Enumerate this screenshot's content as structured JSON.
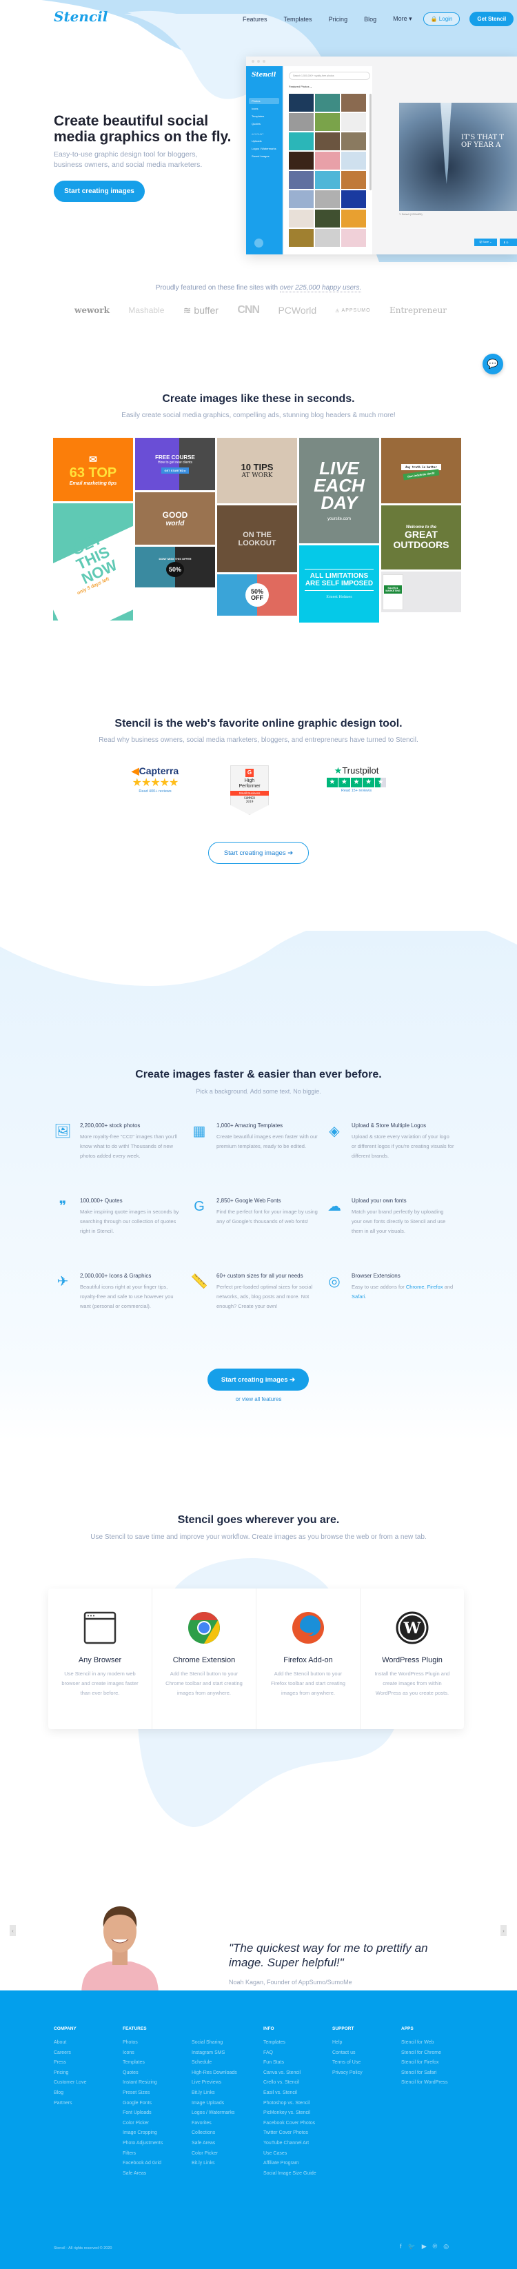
{
  "header": {
    "logo": "Stencil",
    "nav": [
      "Features",
      "Templates",
      "Pricing",
      "Blog"
    ],
    "more": "More ▾",
    "login": "🔒 Login",
    "get_stencil": "Get Stencil"
  },
  "hero": {
    "title": "Create beautiful social media graphics on the fly.",
    "subtitle": "Easy-to-use graphic design tool for bloggers, business owners, and social media marketers.",
    "cta": "Start creating images"
  },
  "app_mock": {
    "logo": "Stencil",
    "sidebar": [
      "Photos",
      "Icons",
      "Templates",
      "Quotes"
    ],
    "account_label": "ACCOUNT",
    "account_items": [
      "Uploads",
      "Logos / Watermarks",
      "Saved Images"
    ],
    "search_placeholder": "Search 1,500,000+ royalty-free photos",
    "featured_label": "Featured Photos ⌄",
    "canvas_text": "IT'S THAT T\nOF YEAR A",
    "canvas_size": "✎ Default (1200x800)",
    "save": "🖫 Save  ⌄",
    "download": "⬇ D",
    "photo_colors": [
      "#1c3a5c",
      "#3e8c84",
      "#8a6a50",
      "#9a9a9a",
      "#7aa34a",
      "#eeeeee",
      "#2bb6b8",
      "#6b5540",
      "#8a7a60",
      "#3a2418",
      "#e8a0a8",
      "#cfe0ee",
      "#6070a0",
      "#4fb6d8",
      "#c07a3a",
      "#9ab0d0",
      "#b0b0b0",
      "#1a3aa0",
      "#e8e0d8",
      "#405030",
      "#e8a030",
      "#a08030",
      "#d0d0d0",
      "#f0d0d8"
    ]
  },
  "featured": {
    "text": "Proudly featured on these fine sites with ",
    "emphasis": "over 225,000 happy users.",
    "logos": [
      "wework",
      "Mashable",
      "≋ buffer",
      "CNN",
      "PCWorld",
      "◬ APPSUMO",
      "Entrepreneur"
    ]
  },
  "gallery": {
    "title": "Create images like these in seconds.",
    "subtitle": "Easily create social media graphics, compelling ads, stunning blog headers & much more!",
    "tiles": {
      "t1_big": "63 TOP",
      "t1_small": "Email marketing tips",
      "t2_big": "GET THIS NOW",
      "t2_small": "only 5 days left",
      "t3_big": "FREE COURSE",
      "t3_small": "How to get new clients",
      "t3_btn": "GET STARTED ▸",
      "t4_big": "GOOD",
      "t4_small": "world",
      "t5_big": "DONT MISS THIS OFFER",
      "t5_badge": "50%",
      "t6_big": "10 TIPS",
      "t6_small": "AT WORK",
      "t7_big": "ON THE LOOKOUT",
      "t8_big": "50% OFF",
      "t9_big": "LIVE EACH DAY",
      "t9_small": "yoursite.com",
      "t10_big": "ALL LIMITATIONS ARE SELF IMPOSED",
      "t10_small": "Ernest Holmes",
      "t11_big": "Any truth is better",
      "t11_small": "than indefinite doubt",
      "t12_small": "Welcome to the",
      "t12_big": "GREAT OUTDOORS",
      "t13_big": "SALES & MARKETING"
    }
  },
  "reviews": {
    "title": "Stencil is the web's favorite online graphic design tool.",
    "subtitle": "Read why business owners, social media marketers, bloggers, and entrepreneurs have turned to Stencil.",
    "capterra": {
      "name": "Capterra",
      "stars": 5,
      "link": "Read 400+ reviews"
    },
    "g2": {
      "g": "G",
      "line1": "High",
      "line2": "Performer",
      "ribbon": "Small Business",
      "season": "SUMMER",
      "year": "2019"
    },
    "trustpilot": {
      "name": "Trustpilot",
      "stars": 4.5,
      "link": "Read 15+ reviews"
    },
    "cta": "Start creating images ➔"
  },
  "features": {
    "title": "Create images faster & easier than ever before.",
    "subtitle": "Pick a background. Add some text. No biggie.",
    "items": [
      {
        "icon": "photos-icon",
        "title": "2,200,000+ stock photos",
        "desc": "More royalty-free \"CC0\" images than you'll know what to do with! Thousands of new photos added every week."
      },
      {
        "icon": "templates-icon",
        "title": "1,000+ Amazing Templates",
        "desc": "Create beautiful images even faster with our premium templates, ready to be edited."
      },
      {
        "icon": "logo-upload-icon",
        "title": "Upload & Store Multiple Logos",
        "desc": "Upload & store every variation of your logo or different logos if you're creating visuals for different brands."
      },
      {
        "icon": "quote-icon",
        "title": "100,000+ Quotes",
        "desc": "Make inspiring quote images in seconds by searching through our collection of quotes right in Stencil."
      },
      {
        "icon": "google-icon",
        "title": "2,850+ Google Web Fonts",
        "desc": "Find the perfect font for your image by using any of Google's thousands of web fonts!"
      },
      {
        "icon": "cloud-upload-icon",
        "title": "Upload your own fonts",
        "desc": "Match your brand perfectly by uploading your own fonts directly to Stencil and use them in all your visuals."
      },
      {
        "icon": "origami-bird-icon",
        "title": "2,000,000+ Icons & Graphics",
        "desc": "Beautiful icons right at your finger tips, royalty-free and safe to use however you want (personal or commercial)."
      },
      {
        "icon": "ruler-icon",
        "title": "60+ custom sizes for all your needs",
        "desc": "Perfect pre-loaded optimal sizes for social networks, ads, blog posts and more. Not enough? Create your own!"
      },
      {
        "icon": "chrome-outline-icon",
        "title": "Browser Extensions",
        "desc_prefix": "Easy to use addons for ",
        "links": [
          "Chrome",
          "Firefox",
          "Safari"
        ],
        "sep1": ", ",
        "sep2": " and ",
        "end": "."
      }
    ],
    "cta": "Start creating images ➔",
    "view_all": "or view all features"
  },
  "platforms": {
    "title": "Stencil goes wherever you are.",
    "subtitle": "Use Stencil to save time and improve your workflow. Create images as you browse the web or from a new tab.",
    "cards": [
      {
        "title": "Any Browser",
        "desc": "Use Stencil in any modern web browser and create images faster than ever before."
      },
      {
        "title": "Chrome Extension",
        "desc": "Add the Stencil button to your Chrome toolbar and start creating images from anywhere."
      },
      {
        "title": "Firefox Add-on",
        "desc": "Add the Stencil button to your Firefox toolbar and start creating images from anywhere."
      },
      {
        "title": "WordPress Plugin",
        "desc": "Install the WordPress Plugin and create images from within WordPress as you create posts."
      }
    ]
  },
  "testimonial": {
    "quote": "\"The quickest way for me to prettify an image. Super helpful!\"",
    "author": "Noah Kagan, Founder of AppSumo/SumoMe",
    "prev": "‹",
    "next": "›"
  },
  "footer": {
    "columns": [
      {
        "heading": "COMPANY",
        "links": [
          "About",
          "Careers",
          "Press",
          "Pricing",
          "Customer Love",
          "Blog",
          "Partners"
        ]
      },
      {
        "heading": "FEATURES",
        "links": [
          "Photos",
          "Icons",
          "Templates",
          "Quotes",
          "Instant Resizing",
          "Preset Sizes",
          "Google Fonts",
          "Font Uploads",
          "Color Picker",
          "Image Cropping",
          "Photo Adjustments",
          "Filters",
          "Facebook Ad Grid",
          "Safe Areas"
        ]
      },
      {
        "heading": "",
        "links": [
          "Social Sharing",
          "Instagram SMS",
          "Schedule",
          "High-Res Downloads",
          "Live Previews",
          "Bit.ly Links",
          "Image Uploads",
          "Logos / Watermarks",
          "Favorites",
          "Collections",
          "Safe Areas",
          "Color Picker",
          "Bit.ly Links"
        ]
      },
      {
        "heading": "INFO",
        "links": [
          "Templates",
          "FAQ",
          "Fun Stats",
          "Canva vs. Stencil",
          "Crello vs. Stencil",
          "Easil vs. Stencil",
          "Photoshop vs. Stencil",
          "PicMonkey vs. Stencil",
          "Facebook Cover Photos",
          "Twitter Cover Photos",
          "YouTube Channel Art",
          "Use Cases",
          "Affiliate Program",
          "Social Image Size Guide"
        ]
      },
      {
        "heading": "SUPPORT",
        "links": [
          "Help",
          "Contact us",
          "Terms of Use",
          "Privacy Policy"
        ]
      },
      {
        "heading": "APPS",
        "links": [
          "Stencil for Web",
          "Stencil for Chrome",
          "Stencil for Firefox",
          "Stencil for Safari",
          "Stencil for WordPress"
        ]
      }
    ],
    "copyright": "Stencil - All rights reserved © 2020",
    "socials": [
      "f",
      "🐦",
      "▶",
      "℗",
      "◎"
    ]
  },
  "colors": {
    "brand": "#169fe9",
    "footer": "#039fec",
    "text_dark": "#1f2a44",
    "text_muted": "#98a6be"
  }
}
